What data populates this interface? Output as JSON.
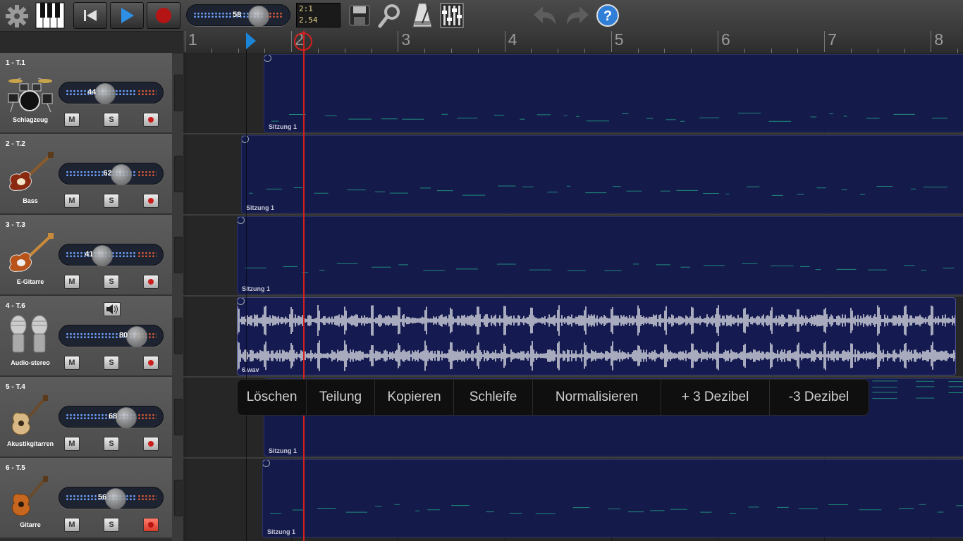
{
  "toolbar": {
    "master_volume": "58",
    "counter_position": "2:1",
    "counter_time": "2.54",
    "icons": [
      "gear-icon",
      "piano-icon",
      "rewind-icon",
      "play-icon",
      "record-icon",
      "save-icon",
      "zoom-icon",
      "metronome-icon",
      "mixer-icon",
      "undo-icon",
      "redo-icon",
      "help-icon"
    ]
  },
  "ruler": {
    "bars": [
      "1",
      "2",
      "3",
      "4",
      "5",
      "6",
      "7",
      "8"
    ]
  },
  "tracks": [
    {
      "id": "1 - T.1",
      "instrument": "Schlagzeug",
      "volume": "44",
      "mute": "M",
      "solo": "S",
      "armed": false,
      "region_label": "Sitzung 1",
      "icon": "drums-icon"
    },
    {
      "id": "2 - T.2",
      "instrument": "Bass",
      "volume": "62",
      "mute": "M",
      "solo": "S",
      "armed": false,
      "region_label": "Sitzung 1",
      "icon": "bass-guitar-icon"
    },
    {
      "id": "3 - T.3",
      "instrument": "E-Gitarre",
      "volume": "41",
      "mute": "M",
      "solo": "S",
      "armed": false,
      "region_label": "Sitzung 1",
      "icon": "electric-guitar-icon"
    },
    {
      "id": "4 - T.6",
      "instrument": "Audio-stereo",
      "volume": "80",
      "mute": "M",
      "solo": "S",
      "armed": false,
      "region_label": "6.wav",
      "icon": "microphones-icon"
    },
    {
      "id": "5 - T.4",
      "instrument": "Akustikgitarren",
      "volume": "68",
      "mute": "M",
      "solo": "S",
      "armed": false,
      "region_label": "Sitzung 1",
      "icon": "acoustic-guitar-icon"
    },
    {
      "id": "6 - T.5",
      "instrument": "Gitarre",
      "volume": "56",
      "mute": "M",
      "solo": "S",
      "armed": true,
      "region_label": "Sitzung 1",
      "icon": "classical-guitar-icon"
    }
  ],
  "context_menu": {
    "items": [
      "Löschen",
      "Teilung",
      "Kopieren",
      "Schleife",
      "Normalisieren",
      "+ 3 Dezibel",
      "-3 Dezibel"
    ]
  },
  "colors": {
    "region": "#141a4a",
    "playhead": "#d42020",
    "loop_marker": "#1b84d6",
    "meter_dots": "#6fa2ff",
    "meter_hot": "#d85a3a"
  }
}
